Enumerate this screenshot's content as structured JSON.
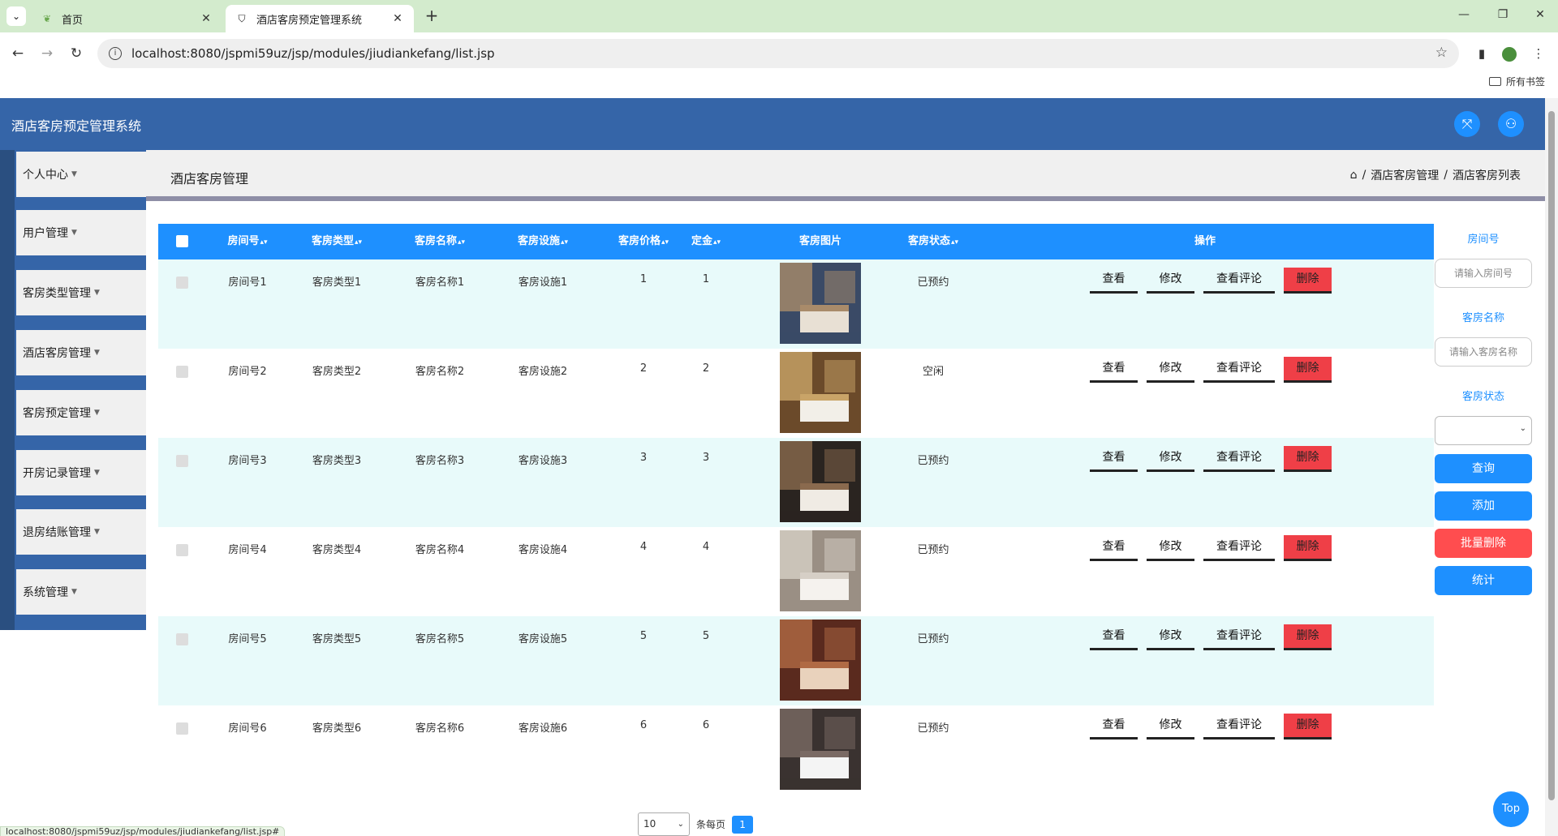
{
  "browser": {
    "tabs": [
      {
        "title": "首页",
        "icon": "leaf-icon"
      },
      {
        "title": "酒店客房预定管理系统",
        "icon": "shield-icon"
      }
    ],
    "url": "localhost:8080/jspmi59uz/jsp/modules/jiudiankefang/list.jsp",
    "bookmarks_label": "所有书签",
    "status_url": "localhost:8080/jspmi59uz/jsp/modules/jiudiankefang/list.jsp#"
  },
  "app": {
    "title": "酒店客房预定管理系统"
  },
  "sidebar": {
    "items": [
      {
        "label": "个人中心"
      },
      {
        "label": "用户管理"
      },
      {
        "label": "客房类型管理"
      },
      {
        "label": "酒店客房管理"
      },
      {
        "label": "客房预定管理"
      },
      {
        "label": "开房记录管理"
      },
      {
        "label": "退房结账管理"
      },
      {
        "label": "系统管理"
      }
    ]
  },
  "page": {
    "title": "酒店客房管理",
    "breadcrumb": [
      "酒店客房管理",
      "酒店客房列表"
    ]
  },
  "table": {
    "headers": [
      "房间号",
      "客房类型",
      "客房名称",
      "客房设施",
      "客房价格",
      "定金",
      "客房图片",
      "客房状态",
      "操作"
    ],
    "actions": {
      "view": "查看",
      "edit": "修改",
      "comments": "查看评论",
      "delete": "删除"
    },
    "rows": [
      {
        "room_no": "房间号1",
        "type": "客房类型1",
        "name": "客房名称1",
        "facility": "客房设施1",
        "price": "1",
        "deposit": "1",
        "status": "已预约",
        "img_tone": [
          "#3a4a66",
          "#a98b6a",
          "#e8e0d4"
        ]
      },
      {
        "room_no": "房间号2",
        "type": "客房类型2",
        "name": "客房名称2",
        "facility": "客房设施2",
        "price": "2",
        "deposit": "2",
        "status": "空闲",
        "img_tone": [
          "#6b4a2a",
          "#c9a468",
          "#f2efe8"
        ]
      },
      {
        "room_no": "房间号3",
        "type": "客房类型3",
        "name": "客房名称3",
        "facility": "客房设施3",
        "price": "3",
        "deposit": "3",
        "status": "已预约",
        "img_tone": [
          "#2a2420",
          "#8a6a4e",
          "#f0ebe4"
        ]
      },
      {
        "room_no": "房间号4",
        "type": "客房类型4",
        "name": "客房名称4",
        "facility": "客房设施4",
        "price": "4",
        "deposit": "4",
        "status": "已预约",
        "img_tone": [
          "#9a8f84",
          "#d6cfc6",
          "#f5f2ee"
        ]
      },
      {
        "room_no": "房间号5",
        "type": "客房类型5",
        "name": "客房名称5",
        "facility": "客房设施5",
        "price": "5",
        "deposit": "5",
        "status": "已预约",
        "img_tone": [
          "#5a2a1e",
          "#b06a44",
          "#e9d2bc"
        ]
      },
      {
        "room_no": "房间号6",
        "type": "客房类型6",
        "name": "客房名称6",
        "facility": "客房设施6",
        "price": "6",
        "deposit": "6",
        "status": "已预约",
        "img_tone": [
          "#3a3230",
          "#7a6a64",
          "#f4f4f4"
        ]
      }
    ]
  },
  "search": {
    "room_no_label": "房间号",
    "room_no_placeholder": "请输入房间号",
    "name_label": "客房名称",
    "name_placeholder": "请输入客房名称",
    "status_label": "客房状态",
    "status_value": "",
    "query_btn": "查询",
    "add_btn": "添加",
    "batch_delete_btn": "批量删除",
    "stats_btn": "统计"
  },
  "pager": {
    "page_size": "10",
    "per_page_label": "条每页",
    "current_page": "1"
  },
  "top_btn": "Top",
  "colors": {
    "header": "#3565a8",
    "accent": "#1e90ff",
    "danger": "#ff4d4f",
    "row_alt": "#e8fafa"
  }
}
